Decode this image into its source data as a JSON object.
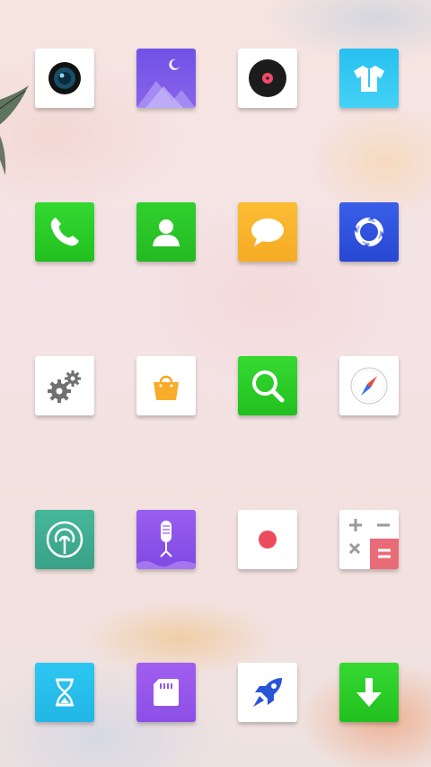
{
  "screen": "home-screen",
  "apps": [
    {
      "icon": "camera-lens-icon",
      "color": "#ffffff"
    },
    {
      "icon": "gallery-moon-mountain-icon",
      "color": "#7a55e6"
    },
    {
      "icon": "vinyl-record-music-icon",
      "color": "#ffffff"
    },
    {
      "icon": "tshirt-theme-icon",
      "color": "#2ec9f3"
    },
    {
      "icon": "phone-handset-icon",
      "color": "#30d02c"
    },
    {
      "icon": "contact-person-icon",
      "color": "#2cc82c"
    },
    {
      "icon": "message-bubble-icon",
      "color": "#f9b52c"
    },
    {
      "icon": "browser-ring-icon",
      "color": "#2f57e0"
    },
    {
      "icon": "settings-gears-icon",
      "color": "#ffffff"
    },
    {
      "icon": "shopping-bag-icon",
      "color": "#ffffff"
    },
    {
      "icon": "search-magnifier-icon",
      "color": "#30d02c"
    },
    {
      "icon": "compass-icon",
      "color": "#ffffff"
    },
    {
      "icon": "hotspot-signal-icon",
      "color": "#3fae94"
    },
    {
      "icon": "microphone-recorder-icon",
      "color": "#8a55e8"
    },
    {
      "icon": "record-dot-icon",
      "color": "#ffffff"
    },
    {
      "icon": "calculator-icon",
      "color": "#ffffff"
    },
    {
      "icon": "hourglass-timer-icon",
      "color": "#2ec9f3"
    },
    {
      "icon": "sd-card-icon",
      "color": "#9a55e8"
    },
    {
      "icon": "rocket-booster-icon",
      "color": "#ffffff"
    },
    {
      "icon": "download-arrow-icon",
      "color": "#30d02c"
    }
  ]
}
